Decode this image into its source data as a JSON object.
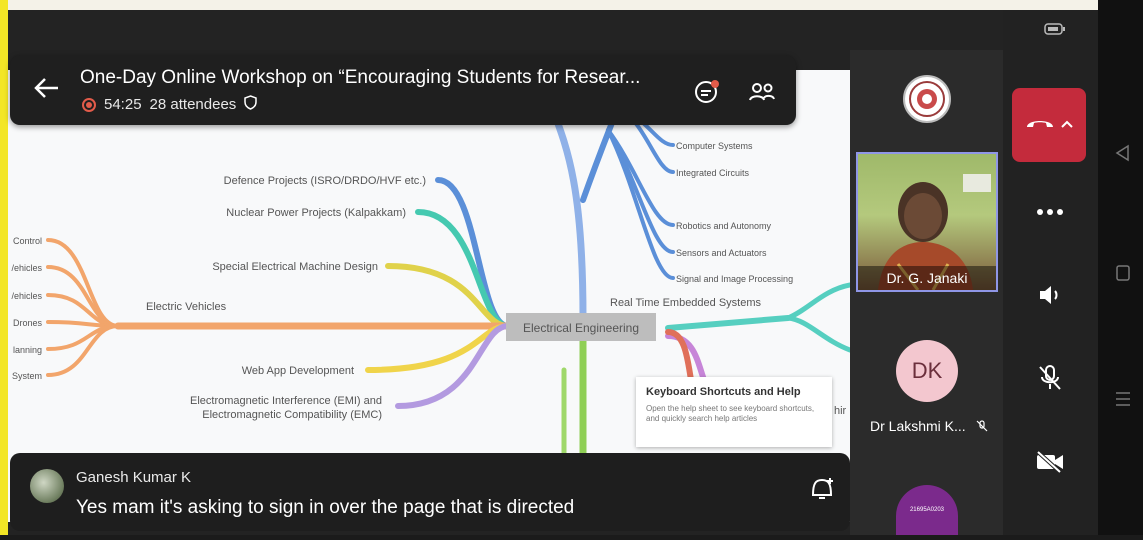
{
  "header": {
    "title": "One-Day Online Workshop on “Encouraging Students for Resear...",
    "duration": "54:25",
    "attendees": "28 attendees"
  },
  "mindmap": {
    "center": "Electrical Engineering",
    "left": {
      "defence": "Defence Projects (ISRO/DRDO/HVF etc.)",
      "nuclear": "Nuclear Power Projects (Kalpakkam)",
      "machine": "Special Electrical Machine Design",
      "ev": "Electric Vehicles",
      "webapp": "Web App Development",
      "emi_line1": "Electromagnetic Interference (EMI) and",
      "emi_line2": "Electromagnetic Compatibility (EMC)",
      "edge": [
        "Control",
        "/ehicles",
        "/ehicles",
        "Drones",
        "lanning",
        "System"
      ]
    },
    "top": {
      "computer": "Computer Systems",
      "ic": "Integrated Circuits",
      "robotics": "Robotics and Autonomy",
      "sensors": "Sensors and Actuators",
      "signal": "Signal and Image Processing"
    },
    "right": {
      "rte": "Real Time Embedded Systems",
      "cut": "hir"
    }
  },
  "shortcuts": {
    "title": "Keyboard Shortcuts and Help",
    "body": "Open the help sheet to see keyboard shortcuts, and quickly search help articles"
  },
  "participants": {
    "video_name": "Dr. G. Janaki",
    "dk_initials": "DK",
    "dk_name": "Dr Lakshmi K...",
    "purple_label": "21695A0203"
  },
  "chat": {
    "sender": "Ganesh Kumar K",
    "message": "Yes mam it's asking to sign in over the page that is directed"
  },
  "colors": {
    "hangup": "#c42b3c",
    "record": "#e25b4a",
    "video_border": "#8f96e6",
    "dk_avatar": "#f3c7cf",
    "purple_avatar": "#7b2a8c"
  },
  "icons": [
    "back-arrow-icon",
    "record-icon",
    "shield-icon",
    "chat-icon",
    "people-icon",
    "hangup-icon",
    "chevron-up-icon",
    "more-icon",
    "speaker-icon",
    "mic-off-icon",
    "video-off-icon",
    "battery-icon",
    "reaction-icon",
    "muted-icon"
  ]
}
